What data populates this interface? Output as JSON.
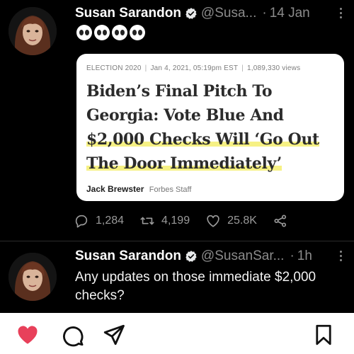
{
  "tweets": [
    {
      "name": "Susan Sarandon",
      "handle": "@Susa...",
      "separator": "·",
      "time": "14 Jan",
      "emoji_text": "👀👀👀👀",
      "card": {
        "category": "ELECTION 2020",
        "date": "Jan 4, 2021, 05:19pm EST",
        "views": "1,089,330 views",
        "headline_plain": "Biden’s Final Pitch To Georgia: Vote Blue And ",
        "headline_highlight": "$2,000 Checks Will ‘Go Out The Door Immediately’",
        "author": "Jack Brewster",
        "author_role": "Forbes Staff"
      },
      "actions": {
        "replies": "1,284",
        "retweets": "4,199",
        "likes": "25.8K"
      }
    },
    {
      "name": "Susan Sarandon",
      "handle": "@SusanSar...",
      "separator": "·",
      "time": "1h",
      "text": "Any updates on those immediate $2,000 checks?"
    }
  ],
  "colors": {
    "background": "#000000",
    "like_active": "#e8405a",
    "highlight": "#f6f184",
    "verified": "#e7e9ea"
  },
  "bottom_bar": {
    "icons": [
      "heart-filled-icon",
      "comment-icon",
      "send-icon",
      "bookmark-icon"
    ]
  }
}
